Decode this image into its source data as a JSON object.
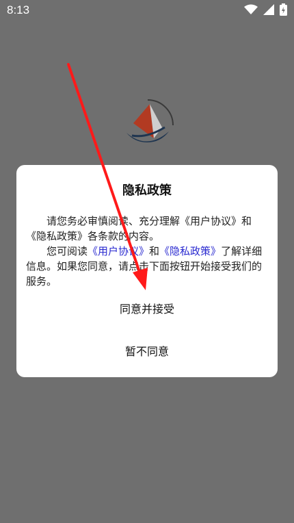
{
  "status_bar": {
    "time": "8:13",
    "icons": [
      "wifi-icon",
      "signal-icon",
      "battery-icon"
    ]
  },
  "background_app": {
    "name": "",
    "logo_colors": [
      "#c0392b",
      "#1f3550",
      "#888888"
    ]
  },
  "dialog": {
    "title": "隐私政策",
    "para1_text": "请您务必审慎阅读、充分理解《用户协议》和《隐私政策》各条款的内容。",
    "para2_prefix": "您可阅读",
    "para2_link_user": "《用户协议》",
    "para2_mid": "和",
    "para2_link_privacy": "《隐私政策》",
    "para2_suffix": "了解详细信息。如果您同意，请点击下面按钮开始接受我们的服务。",
    "accept_label": "同意并接受",
    "decline_label": "暂不同意"
  },
  "colors": {
    "overlay_bg": "#6f6f6f",
    "dialog_bg": "#ffffff",
    "link": "#2a2ad0",
    "annotation_arrow": "#ff1a1a"
  }
}
